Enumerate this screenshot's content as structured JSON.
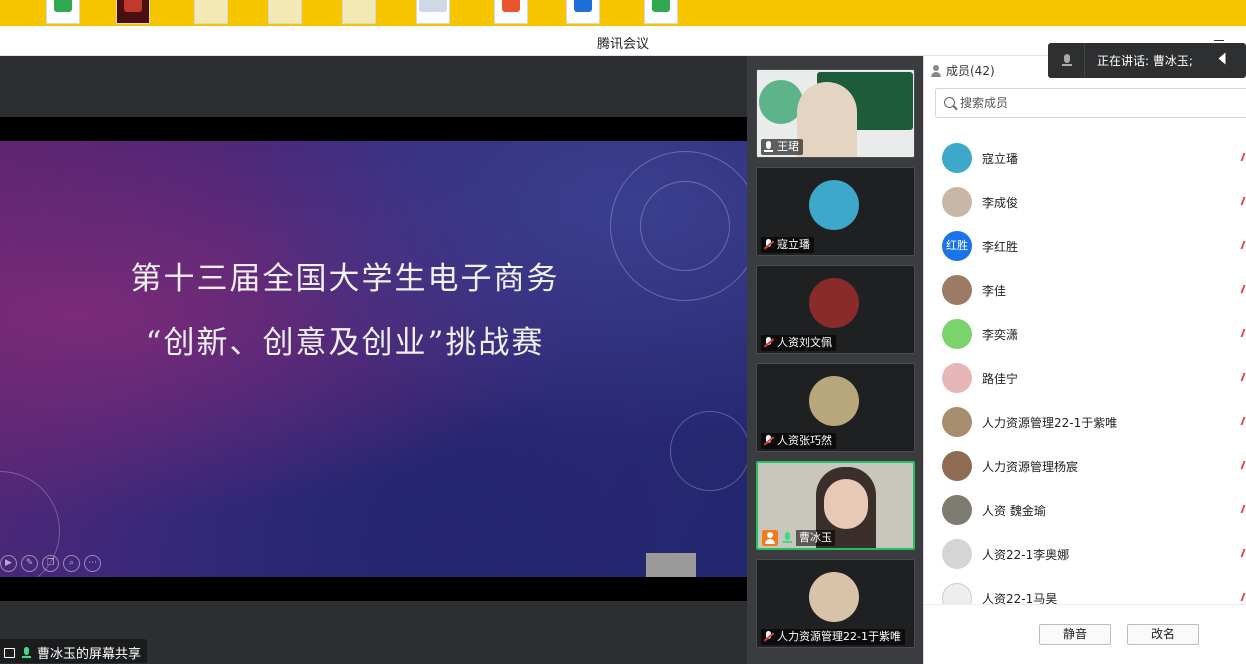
{
  "window": {
    "title": "腾讯会议"
  },
  "slide": {
    "line1": "第十三届全国大学生电子商务",
    "line2": "“创新、创意及创业”挑战赛"
  },
  "share": {
    "label": "曹冰玉的屏幕共享"
  },
  "toast": {
    "text": "正在讲话: 曹冰玉;"
  },
  "videos": [
    {
      "name": "王珺",
      "mic": "on",
      "avatar_color": "#f1efe6"
    },
    {
      "name": "寇立璠",
      "mic": "muted",
      "avatar_color": "#3da8c9"
    },
    {
      "name": "人资刘文佩",
      "mic": "muted",
      "avatar_color": "#8a2b2b"
    },
    {
      "name": "人资张巧然",
      "mic": "muted",
      "avatar_color": "#b8a77a"
    },
    {
      "name": "曹冰玉",
      "mic": "on",
      "avatar_color": "#c9c1b0",
      "host": true,
      "active": true
    },
    {
      "name": "人力资源管理22-1于紫唯",
      "mic": "muted",
      "avatar_color": "#d8c3a8"
    }
  ],
  "members": {
    "header": "成员(42)",
    "search_placeholder": "搜索成员",
    "items": [
      {
        "name": "寇立璠",
        "avatar": "#3da8c9"
      },
      {
        "name": "李成俊",
        "avatar": "#c8b7a6"
      },
      {
        "name": "李红胜",
        "avatar_text": "红胜"
      },
      {
        "name": "李佳",
        "avatar": "#9b7b63"
      },
      {
        "name": "李奕潇",
        "avatar": "#7bd36b"
      },
      {
        "name": "路佳宁",
        "avatar": "#e7b7b7"
      },
      {
        "name": "人力资源管理22-1于紫唯",
        "avatar": "#a68d6e"
      },
      {
        "name": "人力资源管理杨宸",
        "avatar": "#8e6b52"
      },
      {
        "name": "人资 魏金瑜",
        "avatar": "#7d7a70"
      },
      {
        "name": "人资22-1李奥娜",
        "avatar": "#d5d5d5"
      },
      {
        "name": "人资22-1马昊",
        "avatar": "#eeeeee"
      }
    ],
    "mute_button": "静音",
    "rename_button": "改名"
  },
  "colors": {
    "active_border": "#22c160",
    "host_badge": "#f07c1c",
    "toast_bg": "#2e2f31"
  }
}
